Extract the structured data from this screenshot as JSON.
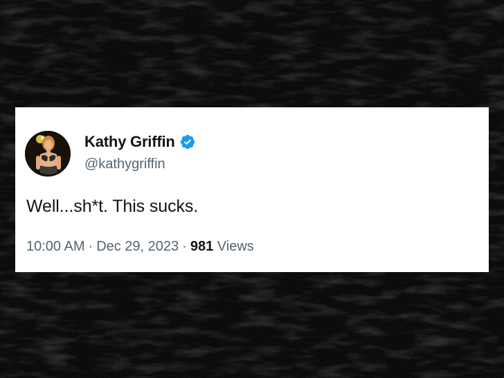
{
  "tweet": {
    "display_name": "Kathy Griffin",
    "handle": "@kathygriffin",
    "text": "Well...sh*t. This sucks.",
    "time": "10:00 AM",
    "separator": "·",
    "date": "Dec 29, 2023",
    "views_count": "981",
    "views_label": "Views",
    "verified": true,
    "verified_icon": "verified-badge-icon"
  },
  "colors": {
    "background": "#0b0b0b",
    "card": "#ffffff",
    "text_primary": "#0f1419",
    "text_secondary": "#536471",
    "verified_blue": "#1d9bf0"
  }
}
